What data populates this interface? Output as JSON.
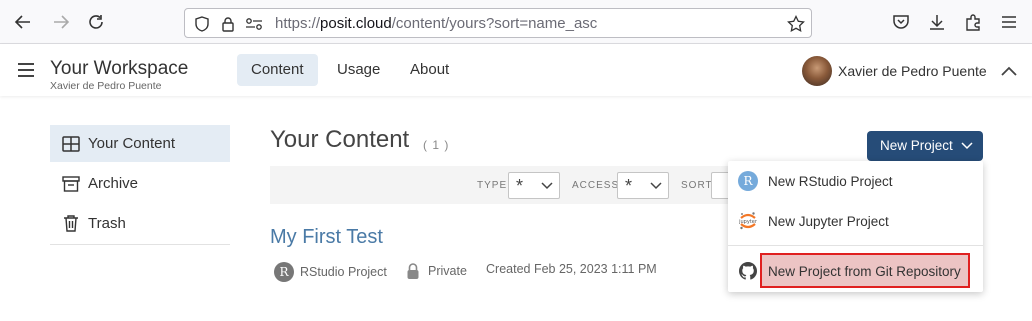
{
  "browser": {
    "url_prefix": "https://",
    "url_host": "posit.cloud",
    "url_path": "/content/yours?sort=name_asc"
  },
  "header": {
    "workspace_title": "Your Workspace",
    "workspace_owner": "Xavier de Pedro Puente",
    "tabs": [
      {
        "label": "Content",
        "active": true
      },
      {
        "label": "Usage",
        "active": false
      },
      {
        "label": "About",
        "active": false
      }
    ],
    "user_name": "Xavier de Pedro Puente"
  },
  "sidebar": {
    "items": [
      {
        "label": "Your Content",
        "icon": "content-icon",
        "active": true
      },
      {
        "label": "Archive",
        "icon": "archive-icon",
        "active": false
      },
      {
        "label": "Trash",
        "icon": "trash-icon",
        "active": false
      }
    ]
  },
  "main": {
    "title": "Your Content",
    "count": "( 1 )",
    "filters": {
      "type_label": "TYPE",
      "type_value": "*",
      "access_label": "ACCESS",
      "access_value": "*",
      "sort_label": "SORT"
    },
    "project": {
      "name": "My First Test",
      "type": "RStudio Project",
      "type_badge": "R",
      "access": "Private",
      "created": "Created Feb 25, 2023 1:11 PM"
    }
  },
  "new_project": {
    "button_label": "New Project",
    "menu": [
      {
        "label": "New RStudio Project",
        "icon": "rstudio-icon",
        "badge": "R"
      },
      {
        "label": "New Jupyter Project",
        "icon": "jupyter-icon"
      },
      {
        "label": "New Project from Git Repository",
        "icon": "github-icon",
        "highlighted": true
      }
    ]
  },
  "colors": {
    "primary_button": "#264c78",
    "active_bg": "#e4ecf4",
    "link": "#4a7aa6",
    "highlight_border": "#e02020",
    "highlight_fill": "#ecc4c4"
  }
}
